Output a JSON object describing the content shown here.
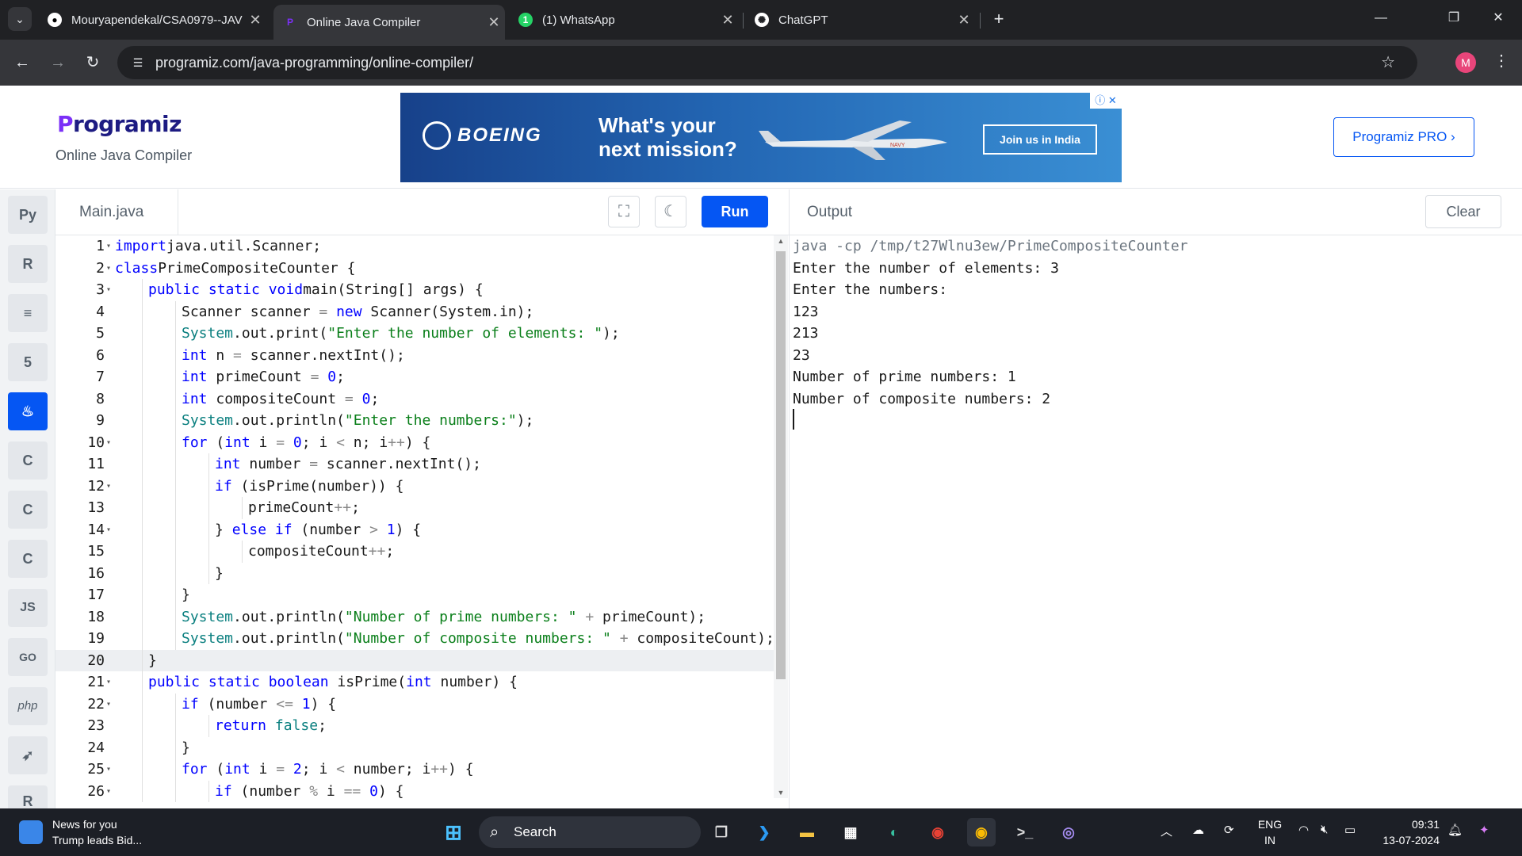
{
  "browser": {
    "tab_menu_icon": "chevron-down-icon",
    "tabs": [
      {
        "title": "Mouryapendekal/CSA0979--JAV",
        "favicon": "github-icon",
        "active": false
      },
      {
        "title": "Online Java Compiler",
        "favicon": "programiz-icon",
        "active": true
      },
      {
        "title": "(1) WhatsApp",
        "favicon": "whatsapp-icon",
        "active": false
      },
      {
        "title": "ChatGPT",
        "favicon": "chatgpt-icon",
        "active": false
      }
    ],
    "url": "programiz.com/java-programming/online-compiler/",
    "profile_initial": "M"
  },
  "header": {
    "logo": "rogramiz",
    "logo_p": "P",
    "subtitle": "Online Java Compiler",
    "ad": {
      "brand": "BOEING",
      "headline": "What's your next mission?",
      "cta": "Join us in India",
      "plane_marking": "NAVY"
    },
    "pro_button": "Programiz PRO ›"
  },
  "rail": {
    "items": [
      {
        "name": "python-icon",
        "glyph": "Py"
      },
      {
        "name": "r-icon",
        "glyph": "R"
      },
      {
        "name": "sql-database-icon",
        "glyph": "≡"
      },
      {
        "name": "html5-icon",
        "glyph": "5"
      },
      {
        "name": "java-icon",
        "glyph": "♨",
        "active": true
      },
      {
        "name": "c-icon",
        "glyph": "C"
      },
      {
        "name": "cpp-icon",
        "glyph": "C"
      },
      {
        "name": "csharp-icon",
        "glyph": "C"
      },
      {
        "name": "javascript-icon",
        "glyph": "JS"
      },
      {
        "name": "go-icon",
        "glyph": "GO"
      },
      {
        "name": "php-icon",
        "glyph": "php"
      },
      {
        "name": "swift-icon",
        "glyph": "➶"
      },
      {
        "name": "rust-icon",
        "glyph": "R"
      }
    ]
  },
  "editor": {
    "file_name": "Main.java",
    "fullscreen_icon": "fullscreen-icon",
    "theme_icon": "moon-icon",
    "run_label": "Run",
    "active_line": 20,
    "lines": [
      {
        "n": "1",
        "fold": true,
        "indent": 0,
        "tokens": [
          [
            "kw",
            "import"
          ],
          [
            "",
            "java.util.Scanner;"
          ]
        ]
      },
      {
        "n": "2",
        "fold": true,
        "indent": 0,
        "tokens": [
          [
            "kw",
            "class"
          ],
          [
            "",
            "PrimeCompositeCounter {"
          ]
        ]
      },
      {
        "n": "3",
        "fold": true,
        "indent": 1,
        "tokens": [
          [
            "kw",
            "public static void"
          ],
          [
            "",
            "main(String[] args) {"
          ]
        ]
      },
      {
        "n": "4",
        "fold": false,
        "indent": 2,
        "tokens": [
          [
            "",
            "Scanner scanner "
          ],
          [
            "op",
            "="
          ],
          [
            "kw",
            " new"
          ],
          [
            "",
            " Scanner(System.in);"
          ]
        ]
      },
      {
        "n": "5",
        "fold": false,
        "indent": 2,
        "tokens": [
          [
            "sys",
            "System"
          ],
          [
            "",
            ".out.print("
          ],
          [
            "str",
            "\"Enter the number of elements: \""
          ],
          [
            "",
            ");"
          ]
        ]
      },
      {
        "n": "6",
        "fold": false,
        "indent": 2,
        "tokens": [
          [
            "kw",
            "int"
          ],
          [
            "",
            " n "
          ],
          [
            "op",
            "="
          ],
          [
            "",
            " scanner.nextInt();"
          ]
        ]
      },
      {
        "n": "7",
        "fold": false,
        "indent": 2,
        "tokens": [
          [
            "kw",
            "int"
          ],
          [
            "",
            " primeCount "
          ],
          [
            "op",
            "="
          ],
          [
            "num",
            " 0"
          ],
          [
            "",
            ";"
          ]
        ]
      },
      {
        "n": "8",
        "fold": false,
        "indent": 2,
        "tokens": [
          [
            "kw",
            "int"
          ],
          [
            "",
            " compositeCount "
          ],
          [
            "op",
            "="
          ],
          [
            "num",
            " 0"
          ],
          [
            "",
            ";"
          ]
        ]
      },
      {
        "n": "9",
        "fold": false,
        "indent": 2,
        "tokens": [
          [
            "sys",
            "System"
          ],
          [
            "",
            ".out.println("
          ],
          [
            "str",
            "\"Enter the numbers:\""
          ],
          [
            "",
            ");"
          ]
        ]
      },
      {
        "n": "10",
        "fold": true,
        "indent": 2,
        "tokens": [
          [
            "kw",
            "for"
          ],
          [
            "",
            " ("
          ],
          [
            "kw",
            "int"
          ],
          [
            "",
            " i "
          ],
          [
            "op",
            "="
          ],
          [
            "num",
            " 0"
          ],
          [
            "",
            "; i "
          ],
          [
            "op",
            "<"
          ],
          [
            "",
            " n; i"
          ],
          [
            "op",
            "++"
          ],
          [
            "",
            ") {"
          ]
        ]
      },
      {
        "n": "11",
        "fold": false,
        "indent": 3,
        "tokens": [
          [
            "kw",
            "int"
          ],
          [
            "",
            " number "
          ],
          [
            "op",
            "="
          ],
          [
            "",
            " scanner.nextInt();"
          ]
        ]
      },
      {
        "n": "12",
        "fold": true,
        "indent": 3,
        "tokens": [
          [
            "kw",
            "if"
          ],
          [
            "",
            " (isPrime(number)) {"
          ]
        ]
      },
      {
        "n": "13",
        "fold": false,
        "indent": 4,
        "tokens": [
          [
            "",
            "primeCount"
          ],
          [
            "op",
            "++"
          ],
          [
            "",
            ";"
          ]
        ]
      },
      {
        "n": "14",
        "fold": true,
        "indent": 3,
        "tokens": [
          [
            "",
            "} "
          ],
          [
            "kw",
            "else if"
          ],
          [
            "",
            " (number "
          ],
          [
            "op",
            ">"
          ],
          [
            "num",
            " 1"
          ],
          [
            "",
            ") {"
          ]
        ]
      },
      {
        "n": "15",
        "fold": false,
        "indent": 4,
        "tokens": [
          [
            "",
            "compositeCount"
          ],
          [
            "op",
            "++"
          ],
          [
            "",
            ";"
          ]
        ]
      },
      {
        "n": "16",
        "fold": false,
        "indent": 3,
        "tokens": [
          [
            "",
            "}"
          ]
        ]
      },
      {
        "n": "17",
        "fold": false,
        "indent": 2,
        "tokens": [
          [
            "",
            "}"
          ]
        ]
      },
      {
        "n": "18",
        "fold": false,
        "indent": 2,
        "tokens": [
          [
            "sys",
            "System"
          ],
          [
            "",
            ".out.println("
          ],
          [
            "str",
            "\"Number of prime numbers: \""
          ],
          [
            "op",
            " +"
          ],
          [
            "",
            " primeCount);"
          ]
        ]
      },
      {
        "n": "19",
        "fold": false,
        "indent": 2,
        "tokens": [
          [
            "sys",
            "System"
          ],
          [
            "",
            ".out.println("
          ],
          [
            "str",
            "\"Number of composite numbers: \""
          ],
          [
            "op",
            " +"
          ],
          [
            "",
            " compositeCount);"
          ]
        ]
      },
      {
        "n": "20",
        "fold": false,
        "indent": 1,
        "tokens": [
          [
            "",
            "}"
          ]
        ]
      },
      {
        "n": "21",
        "fold": true,
        "indent": 1,
        "tokens": [
          [
            "kw",
            "public static boolean"
          ],
          [
            "",
            " isPrime("
          ],
          [
            "kw",
            "int"
          ],
          [
            "",
            " number) {"
          ]
        ]
      },
      {
        "n": "22",
        "fold": true,
        "indent": 2,
        "tokens": [
          [
            "kw",
            "if"
          ],
          [
            "",
            " (number "
          ],
          [
            "op",
            "<="
          ],
          [
            "num",
            " 1"
          ],
          [
            "",
            ") {"
          ]
        ]
      },
      {
        "n": "23",
        "fold": false,
        "indent": 3,
        "tokens": [
          [
            "kw",
            "return"
          ],
          [
            "sys",
            " false"
          ],
          [
            "",
            ";"
          ]
        ]
      },
      {
        "n": "24",
        "fold": false,
        "indent": 2,
        "tokens": [
          [
            "",
            "}"
          ]
        ]
      },
      {
        "n": "25",
        "fold": true,
        "indent": 2,
        "tokens": [
          [
            "kw",
            "for"
          ],
          [
            "",
            " ("
          ],
          [
            "kw",
            "int"
          ],
          [
            "",
            " i "
          ],
          [
            "op",
            "="
          ],
          [
            "num",
            " 2"
          ],
          [
            "",
            "; i "
          ],
          [
            "op",
            "<"
          ],
          [
            "",
            " number; i"
          ],
          [
            "op",
            "++"
          ],
          [
            "",
            ") {"
          ]
        ]
      },
      {
        "n": "26",
        "fold": true,
        "indent": 3,
        "tokens": [
          [
            "kw",
            "if"
          ],
          [
            "",
            " (number "
          ],
          [
            "op",
            "%"
          ],
          [
            "",
            " i "
          ],
          [
            "op",
            "=="
          ],
          [
            "num",
            " 0"
          ],
          [
            "",
            ") {"
          ]
        ]
      }
    ]
  },
  "output": {
    "title": "Output",
    "clear_label": "Clear",
    "lines": [
      {
        "text": "java -cp /tmp/t27Wlnu3ew/PrimeCompositeCounter",
        "cmd": true
      },
      {
        "text": "Enter the number of elements: 3"
      },
      {
        "text": "Enter the numbers:"
      },
      {
        "text": "123"
      },
      {
        "text": "213"
      },
      {
        "text": "23"
      },
      {
        "text": "Number of prime numbers: 1"
      },
      {
        "text": "Number of composite numbers: 2"
      }
    ]
  },
  "taskbar": {
    "news_title": "News for you",
    "news_sub": "Trump leads Bid...",
    "search_label": "Search",
    "apps": [
      "windows-start-icon",
      "task-view-icon",
      "vscode-icon",
      "file-explorer-icon",
      "ms-store-icon",
      "edge-icon",
      "chrome-icon",
      "chrome-profile-icon",
      "terminal-icon",
      "eclipse-icon"
    ],
    "lang_top": "ENG",
    "lang_bottom": "IN",
    "time": "09:31",
    "date": "13-07-2024"
  },
  "colors": {
    "accent": "#0556f3",
    "chrome_dark": "#202124",
    "chrome_mid": "#35363a"
  }
}
